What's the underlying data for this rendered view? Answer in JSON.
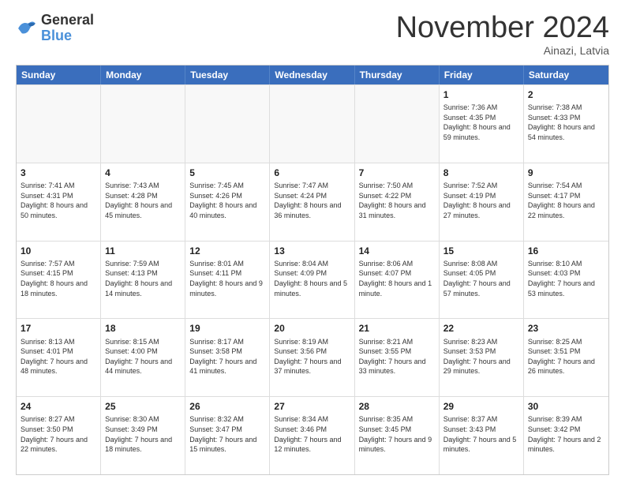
{
  "header": {
    "logo_line1": "General",
    "logo_line2": "Blue",
    "month": "November 2024",
    "location": "Ainazi, Latvia"
  },
  "days_of_week": [
    "Sunday",
    "Monday",
    "Tuesday",
    "Wednesday",
    "Thursday",
    "Friday",
    "Saturday"
  ],
  "weeks": [
    [
      {
        "day": "",
        "info": ""
      },
      {
        "day": "",
        "info": ""
      },
      {
        "day": "",
        "info": ""
      },
      {
        "day": "",
        "info": ""
      },
      {
        "day": "",
        "info": ""
      },
      {
        "day": "1",
        "info": "Sunrise: 7:36 AM\nSunset: 4:35 PM\nDaylight: 8 hours\nand 59 minutes."
      },
      {
        "day": "2",
        "info": "Sunrise: 7:38 AM\nSunset: 4:33 PM\nDaylight: 8 hours\nand 54 minutes."
      }
    ],
    [
      {
        "day": "3",
        "info": "Sunrise: 7:41 AM\nSunset: 4:31 PM\nDaylight: 8 hours\nand 50 minutes."
      },
      {
        "day": "4",
        "info": "Sunrise: 7:43 AM\nSunset: 4:28 PM\nDaylight: 8 hours\nand 45 minutes."
      },
      {
        "day": "5",
        "info": "Sunrise: 7:45 AM\nSunset: 4:26 PM\nDaylight: 8 hours\nand 40 minutes."
      },
      {
        "day": "6",
        "info": "Sunrise: 7:47 AM\nSunset: 4:24 PM\nDaylight: 8 hours\nand 36 minutes."
      },
      {
        "day": "7",
        "info": "Sunrise: 7:50 AM\nSunset: 4:22 PM\nDaylight: 8 hours\nand 31 minutes."
      },
      {
        "day": "8",
        "info": "Sunrise: 7:52 AM\nSunset: 4:19 PM\nDaylight: 8 hours\nand 27 minutes."
      },
      {
        "day": "9",
        "info": "Sunrise: 7:54 AM\nSunset: 4:17 PM\nDaylight: 8 hours\nand 22 minutes."
      }
    ],
    [
      {
        "day": "10",
        "info": "Sunrise: 7:57 AM\nSunset: 4:15 PM\nDaylight: 8 hours\nand 18 minutes."
      },
      {
        "day": "11",
        "info": "Sunrise: 7:59 AM\nSunset: 4:13 PM\nDaylight: 8 hours\nand 14 minutes."
      },
      {
        "day": "12",
        "info": "Sunrise: 8:01 AM\nSunset: 4:11 PM\nDaylight: 8 hours\nand 9 minutes."
      },
      {
        "day": "13",
        "info": "Sunrise: 8:04 AM\nSunset: 4:09 PM\nDaylight: 8 hours\nand 5 minutes."
      },
      {
        "day": "14",
        "info": "Sunrise: 8:06 AM\nSunset: 4:07 PM\nDaylight: 8 hours\nand 1 minute."
      },
      {
        "day": "15",
        "info": "Sunrise: 8:08 AM\nSunset: 4:05 PM\nDaylight: 7 hours\nand 57 minutes."
      },
      {
        "day": "16",
        "info": "Sunrise: 8:10 AM\nSunset: 4:03 PM\nDaylight: 7 hours\nand 53 minutes."
      }
    ],
    [
      {
        "day": "17",
        "info": "Sunrise: 8:13 AM\nSunset: 4:01 PM\nDaylight: 7 hours\nand 48 minutes."
      },
      {
        "day": "18",
        "info": "Sunrise: 8:15 AM\nSunset: 4:00 PM\nDaylight: 7 hours\nand 44 minutes."
      },
      {
        "day": "19",
        "info": "Sunrise: 8:17 AM\nSunset: 3:58 PM\nDaylight: 7 hours\nand 41 minutes."
      },
      {
        "day": "20",
        "info": "Sunrise: 8:19 AM\nSunset: 3:56 PM\nDaylight: 7 hours\nand 37 minutes."
      },
      {
        "day": "21",
        "info": "Sunrise: 8:21 AM\nSunset: 3:55 PM\nDaylight: 7 hours\nand 33 minutes."
      },
      {
        "day": "22",
        "info": "Sunrise: 8:23 AM\nSunset: 3:53 PM\nDaylight: 7 hours\nand 29 minutes."
      },
      {
        "day": "23",
        "info": "Sunrise: 8:25 AM\nSunset: 3:51 PM\nDaylight: 7 hours\nand 26 minutes."
      }
    ],
    [
      {
        "day": "24",
        "info": "Sunrise: 8:27 AM\nSunset: 3:50 PM\nDaylight: 7 hours\nand 22 minutes."
      },
      {
        "day": "25",
        "info": "Sunrise: 8:30 AM\nSunset: 3:49 PM\nDaylight: 7 hours\nand 18 minutes."
      },
      {
        "day": "26",
        "info": "Sunrise: 8:32 AM\nSunset: 3:47 PM\nDaylight: 7 hours\nand 15 minutes."
      },
      {
        "day": "27",
        "info": "Sunrise: 8:34 AM\nSunset: 3:46 PM\nDaylight: 7 hours\nand 12 minutes."
      },
      {
        "day": "28",
        "info": "Sunrise: 8:35 AM\nSunset: 3:45 PM\nDaylight: 7 hours\nand 9 minutes."
      },
      {
        "day": "29",
        "info": "Sunrise: 8:37 AM\nSunset: 3:43 PM\nDaylight: 7 hours\nand 5 minutes."
      },
      {
        "day": "30",
        "info": "Sunrise: 8:39 AM\nSunset: 3:42 PM\nDaylight: 7 hours\nand 2 minutes."
      }
    ]
  ]
}
